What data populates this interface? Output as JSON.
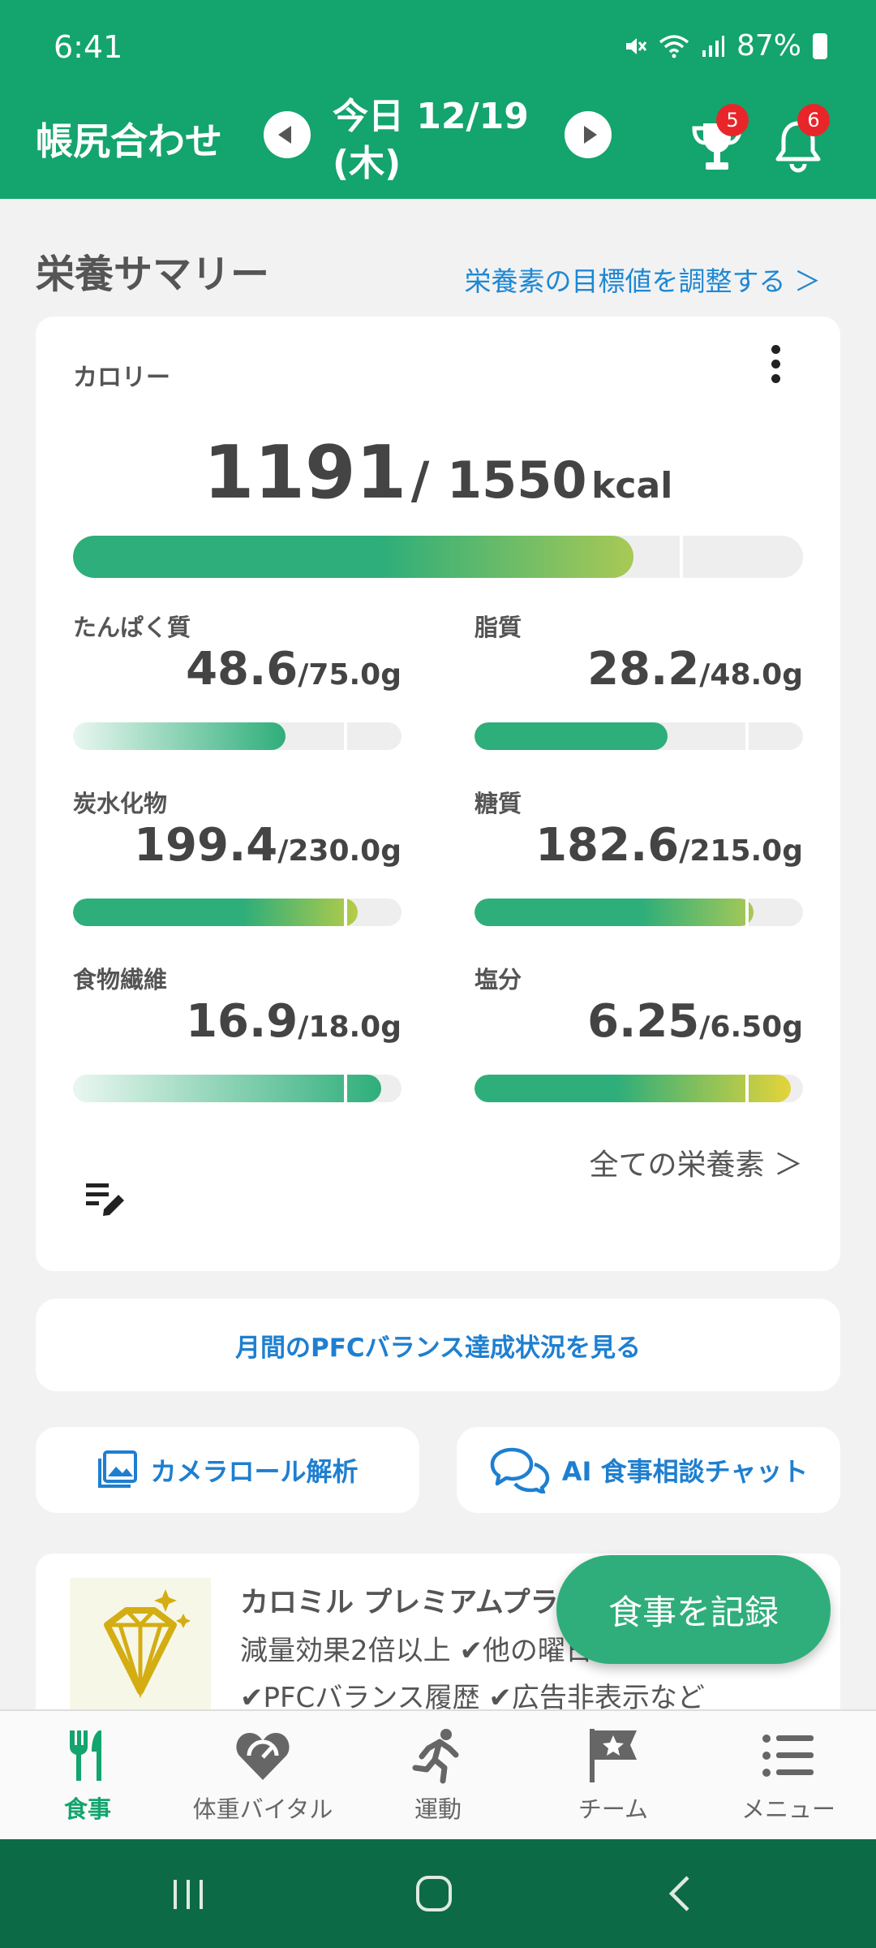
{
  "status_bar": {
    "time": "6:41",
    "battery": "87%"
  },
  "header": {
    "title": "帳尻合わせ",
    "date_line1": "今日 12/19",
    "date_line2": "(木)",
    "trophy_badge": "5",
    "bell_badge": "6"
  },
  "summary": {
    "title": "栄養サマリー",
    "adjust_link": "栄養素の目標値を調整する ＞"
  },
  "calorie": {
    "label": "カロリー",
    "current": "1191",
    "target": "/ 1550",
    "unit": "kcal",
    "progress": 0.768
  },
  "nutrients": [
    {
      "label": "たんぱく質",
      "current": "48.6",
      "target": "/75.0g",
      "progress": 0.648
    },
    {
      "label": "脂質",
      "current": "28.2",
      "target": "/48.0g",
      "progress": 0.588
    },
    {
      "label": "炭水化物",
      "current": "199.4",
      "target": "/230.0g",
      "progress": 0.867
    },
    {
      "label": "糖質",
      "current": "182.6",
      "target": "/215.0g",
      "progress": 0.849
    },
    {
      "label": "食物繊維",
      "current": "16.9",
      "target": "/18.0g",
      "progress": 0.939
    },
    {
      "label": "塩分",
      "current": "6.25",
      "target": "/6.50g",
      "progress": 0.962
    }
  ],
  "all_nutrients_link": "全ての栄養素 ＞",
  "buttons": {
    "pfc": "月間のPFCバランス達成状況を見る",
    "camera": "カメラロール解析",
    "chat": "AI 食事相談チャット"
  },
  "premium": {
    "title": "カロミル プレミアムプラン",
    "line1": "減量効果2倍以上 ✔他の曜日",
    "line2": "✔PFCバランス履歴 ✔広告非表示など"
  },
  "fab_label": "食事を記録",
  "tabs": [
    {
      "label": "食事",
      "icon": "fork-knife-icon",
      "active": true
    },
    {
      "label": "体重バイタル",
      "icon": "heart-scale-icon",
      "active": false
    },
    {
      "label": "運動",
      "icon": "running-icon",
      "active": false
    },
    {
      "label": "チーム",
      "icon": "flag-icon",
      "active": false
    },
    {
      "label": "メニュー",
      "icon": "menu-list-icon",
      "active": false
    }
  ],
  "colors": {
    "primary": "#14a46e",
    "link": "#1e88d4",
    "badge": "#e8262a"
  }
}
